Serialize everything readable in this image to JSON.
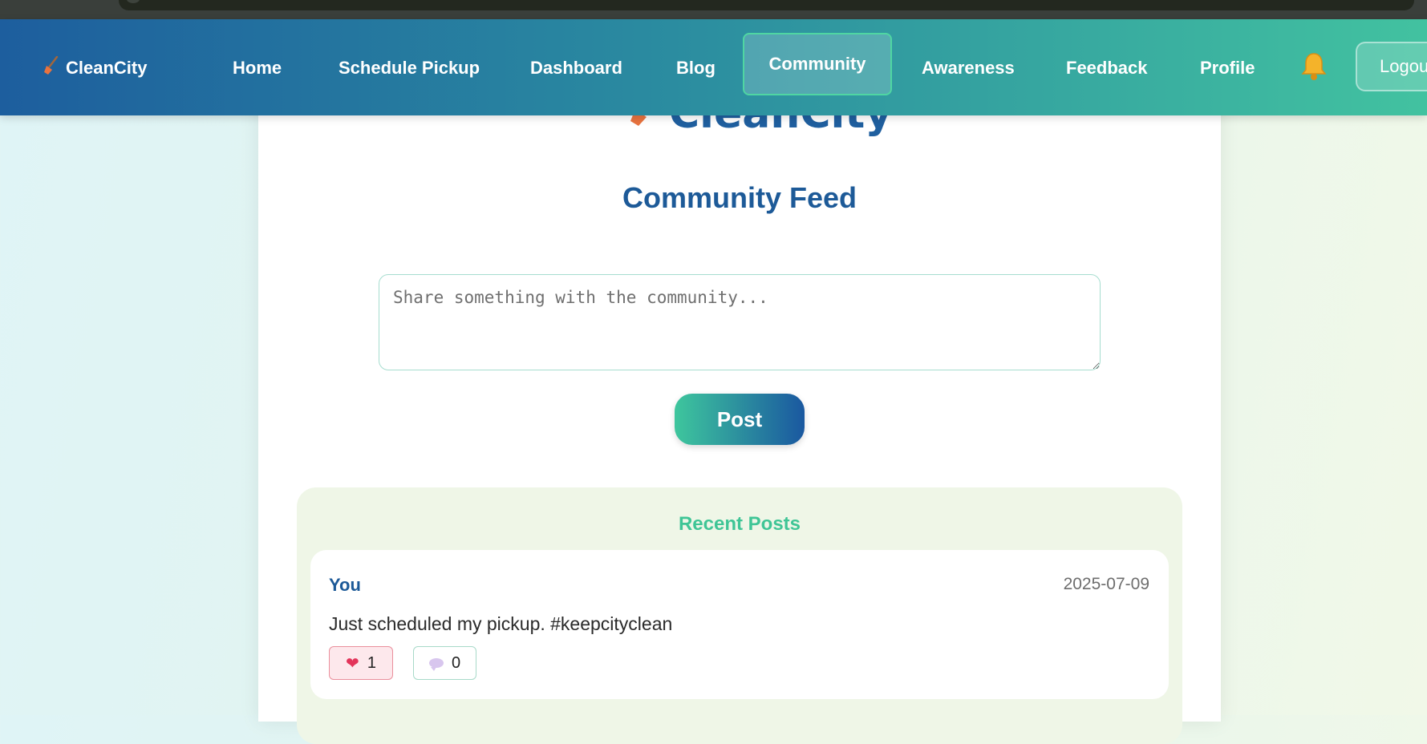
{
  "app": {
    "brand": "CleanCity",
    "brand_icon": "broom-icon"
  },
  "nav": {
    "items": [
      {
        "label": "Home"
      },
      {
        "label": "Schedule Pickup"
      },
      {
        "label": "Dashboard"
      },
      {
        "label": "Blog"
      },
      {
        "label": "Community",
        "active": true
      },
      {
        "label": "Awareness"
      },
      {
        "label": "Feedback"
      },
      {
        "label": "Profile"
      }
    ],
    "notification_icon": "bell-icon",
    "logout_label": "Logou"
  },
  "main": {
    "logo_text": "CleanCity",
    "title": "Community Feed",
    "composer": {
      "value": "",
      "placeholder": "Share something with the community..."
    },
    "post_button": "Post",
    "recent": {
      "title": "Recent Posts",
      "posts": [
        {
          "author": "You",
          "date": "2025-07-09",
          "text": "Just scheduled my pickup. #keepcityclean",
          "likes": "1",
          "comments": "0"
        }
      ]
    }
  },
  "colors": {
    "nav_gradient_start": "#1d5e9e",
    "nav_gradient_end": "#42c2a0",
    "accent_blue": "#1d5a98",
    "accent_green": "#3fc596"
  }
}
